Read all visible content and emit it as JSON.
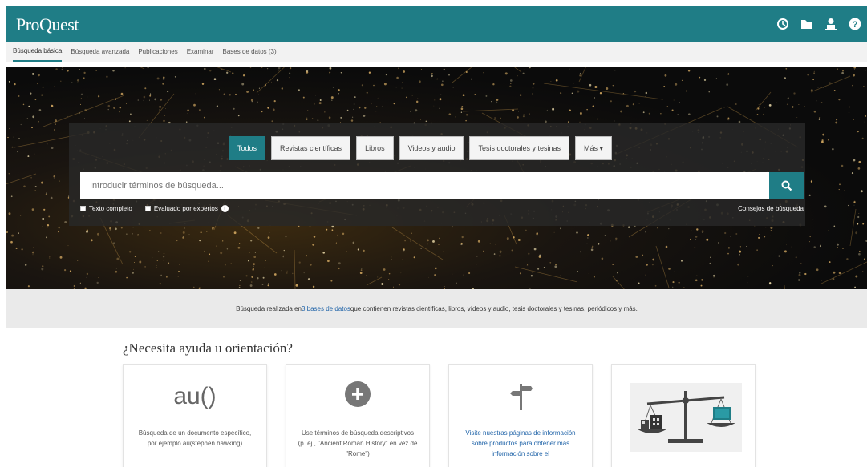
{
  "header": {
    "logo": "ProQuest",
    "icons": [
      "history-icon",
      "folder-icon",
      "user-icon",
      "help-icon"
    ]
  },
  "nav": {
    "items": [
      {
        "label": "Búsqueda básica",
        "active": true
      },
      {
        "label": "Búsqueda avanzada",
        "active": false
      },
      {
        "label": "Publicaciones",
        "active": false
      },
      {
        "label": "Examinar",
        "active": false
      },
      {
        "label": "Bases de datos (3)",
        "active": false
      }
    ]
  },
  "search": {
    "tabs": [
      {
        "label": "Todos",
        "active": true
      },
      {
        "label": "Revistas científicas",
        "active": false
      },
      {
        "label": "Libros",
        "active": false
      },
      {
        "label": "Videos y audio",
        "active": false
      },
      {
        "label": "Tesis doctorales y tesinas",
        "active": false
      },
      {
        "label": "Más ▾",
        "active": false
      }
    ],
    "placeholder": "Introducir términos de búsqueda...",
    "full_text_label": "Texto completo",
    "peer_reviewed_label": "Evaluado por expertos",
    "tips_label": "Consejos de búsqueda"
  },
  "strip": {
    "prefix": "Búsqueda realizada en ",
    "link": "3 bases de datos",
    "suffix": " que contienen revistas científicas, libros, vídeos y audio, tesis doctorales y tesinas, periódicos y más."
  },
  "help": {
    "title": "¿Necesita ayuda u orientación?",
    "cards": [
      {
        "icon_text": "au()",
        "text": "Búsqueda de un documento específico, por ejemplo au(stephen hawking)"
      },
      {
        "icon": "plus-circle-icon",
        "text": "Use términos de búsqueda descriptivos (p. ej., \"Ancient Roman History\" en vez de \"Rome\")"
      },
      {
        "icon": "signpost-icon",
        "text": "Visite nuestras páginas de información sobre productos para obtener más información sobre el"
      },
      {
        "icon": "scale-image",
        "text": ""
      }
    ]
  },
  "colors": {
    "teal": "#1f7d86",
    "link": "#1f63a8"
  }
}
